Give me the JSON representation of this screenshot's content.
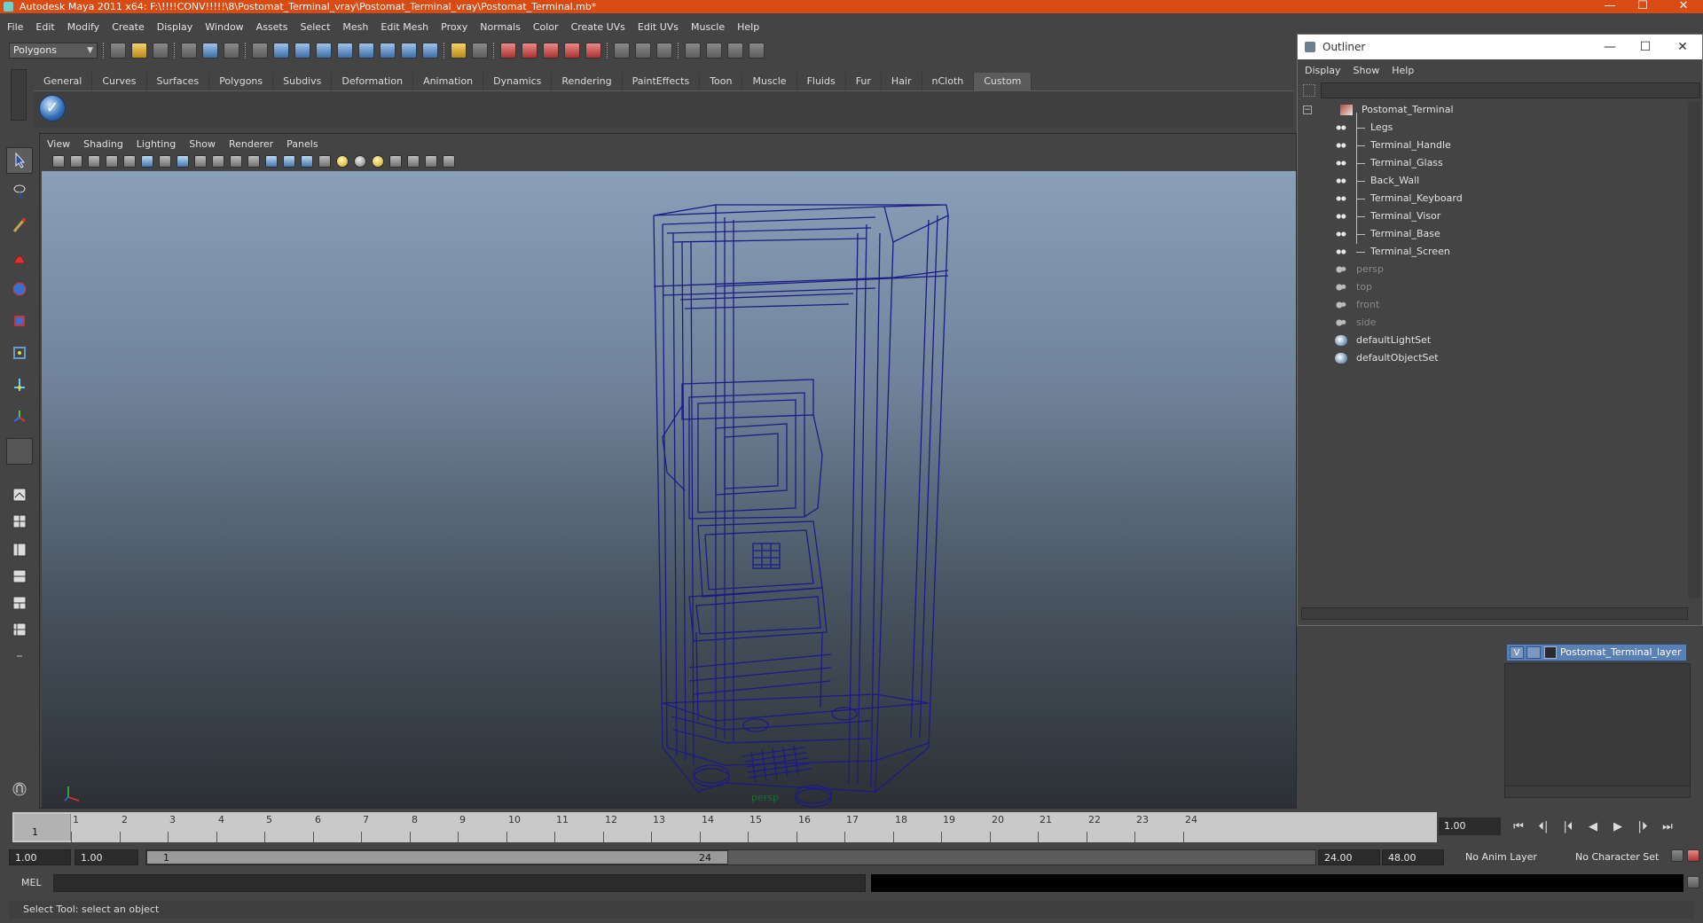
{
  "window": {
    "title": "Autodesk Maya 2011 x64: F:\\!!!!CONV!!!!!\\8\\Postomat_Terminal_vray\\Postomat_Terminal_vray\\Postomat_Terminal.mb*",
    "controls": [
      "—",
      "☐",
      "✕"
    ]
  },
  "menubar": [
    "File",
    "Edit",
    "Modify",
    "Create",
    "Display",
    "Window",
    "Assets",
    "Select",
    "Mesh",
    "Edit Mesh",
    "Proxy",
    "Normals",
    "Color",
    "Create UVs",
    "Edit UVs",
    "Muscle",
    "Help"
  ],
  "statusline": {
    "mode": "Polygons"
  },
  "shelf": {
    "tabs": [
      "General",
      "Curves",
      "Surfaces",
      "Polygons",
      "Subdivs",
      "Deformation",
      "Animation",
      "Dynamics",
      "Rendering",
      "PaintEffects",
      "Toon",
      "Muscle",
      "Fluids",
      "Fur",
      "Hair",
      "nCloth",
      "Custom"
    ],
    "active_tab": "Custom"
  },
  "viewport": {
    "menu": [
      "View",
      "Shading",
      "Lighting",
      "Show",
      "Renderer",
      "Panels"
    ],
    "camera": "persp"
  },
  "outliner": {
    "title": "Outliner",
    "menu": [
      "Display",
      "Show",
      "Help"
    ],
    "items": [
      {
        "label": "Postomat_Terminal",
        "type": "group",
        "dim": false
      },
      {
        "label": "Legs",
        "type": "mesh",
        "dim": false
      },
      {
        "label": "Terminal_Handle",
        "type": "mesh",
        "dim": false
      },
      {
        "label": "Terminal_Glass",
        "type": "mesh",
        "dim": false
      },
      {
        "label": "Back_Wall",
        "type": "mesh",
        "dim": false
      },
      {
        "label": "Terminal_Keyboard",
        "type": "mesh",
        "dim": false
      },
      {
        "label": "Terminal_Visor",
        "type": "mesh",
        "dim": false
      },
      {
        "label": "Terminal_Base",
        "type": "mesh",
        "dim": false
      },
      {
        "label": "Terminal_Screen",
        "type": "mesh",
        "dim": false
      },
      {
        "label": "persp",
        "type": "camera",
        "dim": true
      },
      {
        "label": "top",
        "type": "camera",
        "dim": true
      },
      {
        "label": "front",
        "type": "camera",
        "dim": true
      },
      {
        "label": "side",
        "type": "camera",
        "dim": true
      },
      {
        "label": "defaultLightSet",
        "type": "set",
        "dim": false
      },
      {
        "label": "defaultObjectSet",
        "type": "set",
        "dim": false
      }
    ]
  },
  "layers": {
    "items": [
      {
        "visible_flag": "V",
        "name": "Postomat_Terminal_layer"
      }
    ]
  },
  "timeline": {
    "ticks": [
      "1",
      "2",
      "3",
      "4",
      "5",
      "6",
      "7",
      "8",
      "9",
      "10",
      "11",
      "12",
      "13",
      "14",
      "15",
      "16",
      "17",
      "18",
      "19",
      "20",
      "21",
      "22",
      "23",
      "24"
    ],
    "current_frame": "1",
    "current_frame_field": "1.00"
  },
  "playback": {
    "buttons": [
      "⏮",
      "⏴|",
      "|⏴",
      "◀",
      "▶",
      "|⏵",
      "⏭"
    ]
  },
  "range": {
    "start": "1.00",
    "anim_start": "1.00",
    "slider_lo": "1",
    "slider_hi": "24",
    "anim_end": "24.00",
    "end": "48.00",
    "anim_layer": "No Anim Layer",
    "character_set": "No Character Set"
  },
  "command": {
    "label": "MEL"
  },
  "help": {
    "text": "Select Tool: select an object"
  },
  "colors": {
    "titlebar": "#d94b13",
    "wireframe": "#1a1a8c",
    "layer_row": "#5a7fb2"
  }
}
